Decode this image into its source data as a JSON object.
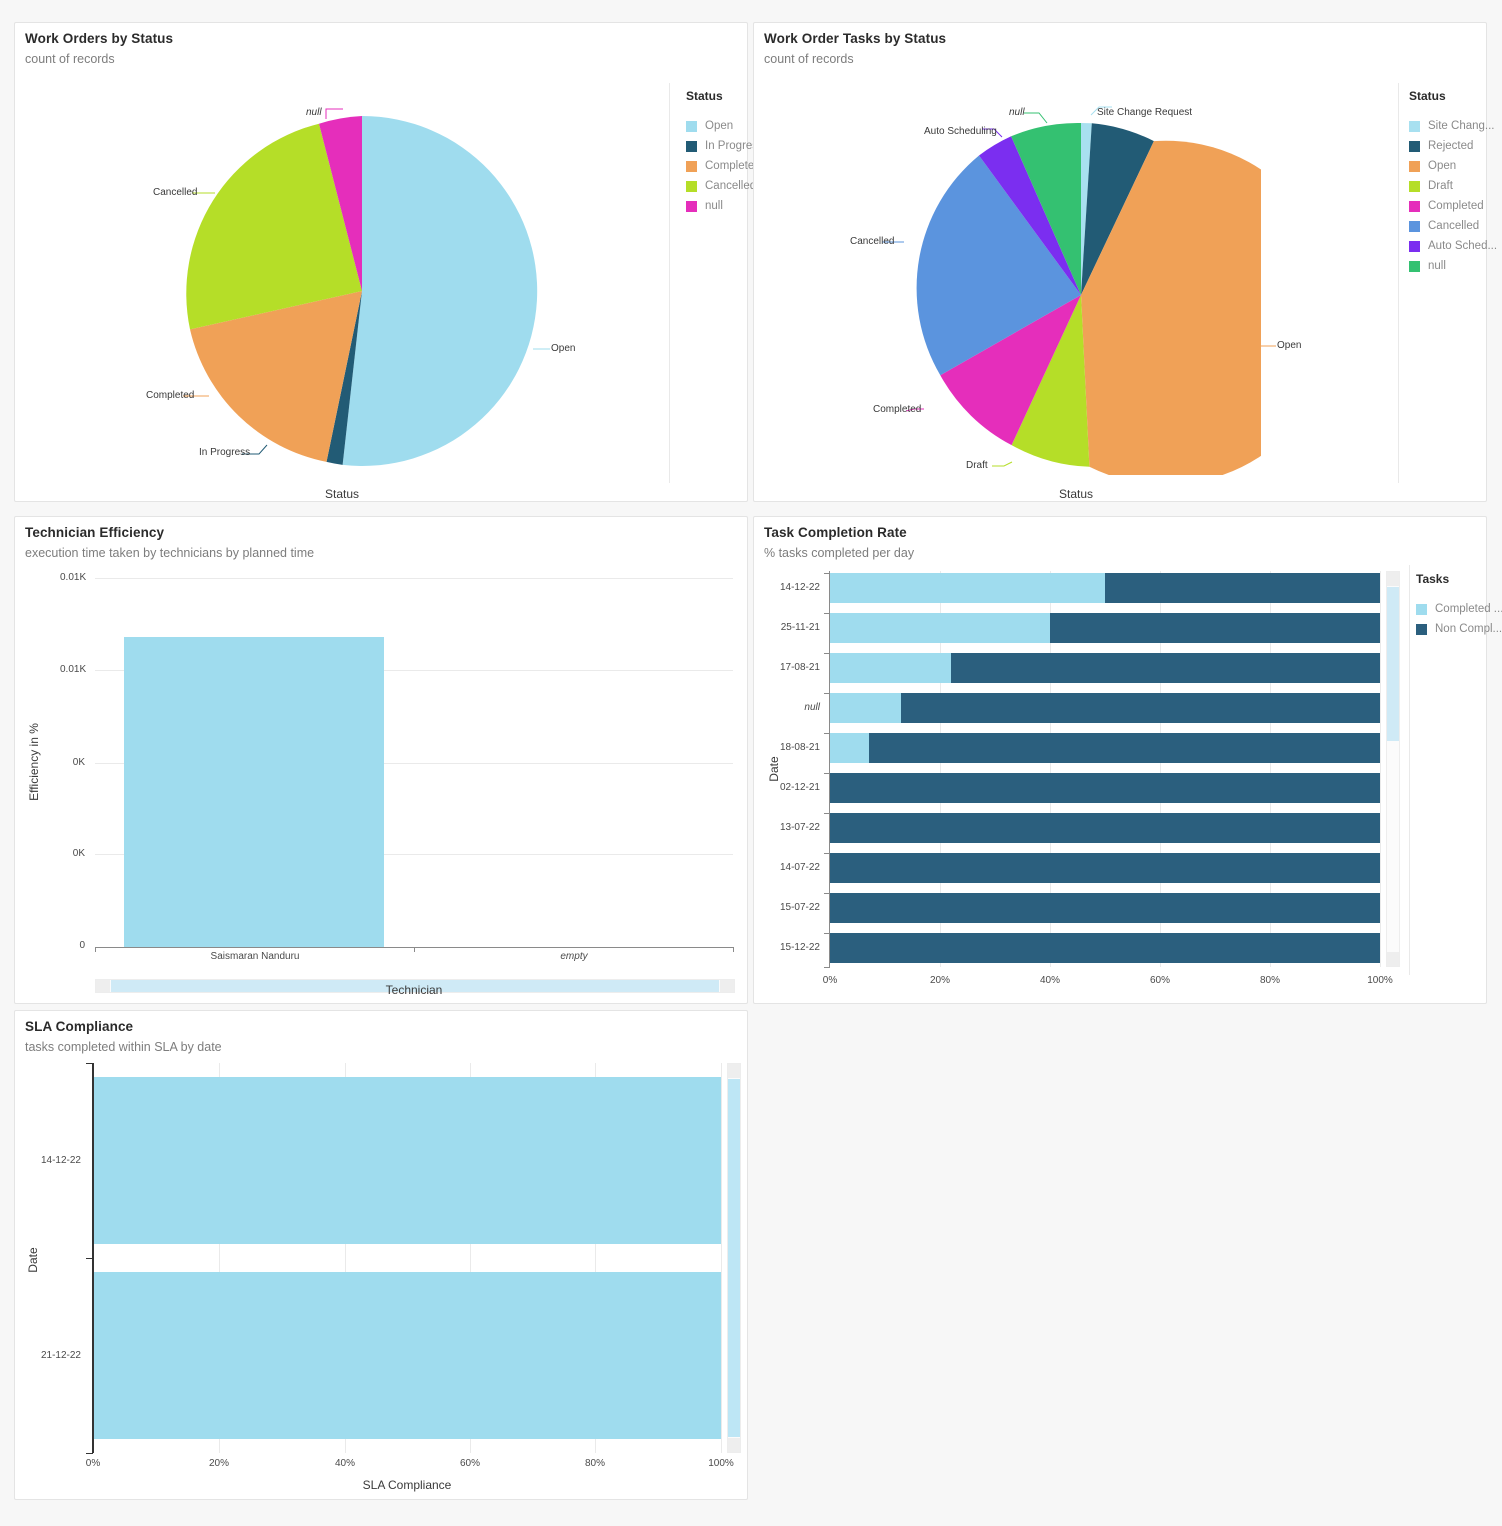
{
  "theme": {
    "page_bg": "#f7f7f7",
    "panel_bg": "#ffffff",
    "panel_border": "#e4e4e4",
    "text_dark": "#2b2b2b",
    "text_muted": "#7d7d7d",
    "light_blue": "#9fdcee",
    "dark_blue": "#2b5f7e"
  },
  "panels": {
    "work_orders": {
      "title": "Work Orders by Status",
      "subtitle": "count of records",
      "axis_title": "Status",
      "legend_title": "Status"
    },
    "work_order_tasks": {
      "title": "Work Order Tasks by Status",
      "subtitle": "count of records",
      "axis_title": "Status",
      "legend_title": "Status"
    },
    "technician_efficiency": {
      "title": "Technician Efficiency",
      "subtitle": "execution time taken by technicians by planned time",
      "x_axis_title": "Technician",
      "y_axis_title": "Efficiency in %"
    },
    "task_completion": {
      "title": "Task Completion Rate",
      "subtitle": "% tasks completed per day",
      "y_axis_title": "Date",
      "legend_title": "Tasks"
    },
    "sla_compliance": {
      "title": "SLA Compliance",
      "subtitle": "tasks completed within SLA by date",
      "x_axis_title": "SLA Compliance",
      "y_axis_title": "Date"
    }
  },
  "chart_data": [
    {
      "id": "work_orders_by_status",
      "type": "pie",
      "title": "Work Orders by Status",
      "subtitle": "count of records",
      "xlabel": "Status",
      "legend_title": "Status",
      "legend_position": "right",
      "labels": [
        "Open",
        "In Progress",
        "Completed",
        "Cancelled",
        "null"
      ],
      "values": [
        56.5,
        1.5,
        11.5,
        26.5,
        4.0
      ],
      "unit": "percent",
      "colors": [
        "#9fdcee",
        "#225b75",
        "#f0a157",
        "#b5de28",
        "#e52ebb"
      ],
      "slice_labels": [
        {
          "text": "Open",
          "italic": false
        },
        {
          "text": "In Progress",
          "italic": false
        },
        {
          "text": "Completed",
          "italic": false
        },
        {
          "text": "Cancelled",
          "italic": false
        },
        {
          "text": "null",
          "italic": true
        }
      ],
      "legend_entries": [
        "Open",
        "In Progress",
        "Completed",
        "Cancelled",
        "null"
      ]
    },
    {
      "id": "work_order_tasks_by_status",
      "type": "pie",
      "title": "Work Order Tasks by Status",
      "subtitle": "count of records",
      "xlabel": "Status",
      "legend_title": "Status",
      "legend_position": "right",
      "labels": [
        "Site Change Request",
        "Rejected",
        "Open",
        "Draft",
        "Completed",
        "Cancelled",
        "Auto Scheduling",
        "null"
      ],
      "values": [
        1.0,
        6.5,
        43.0,
        7.5,
        8.0,
        22.0,
        3.5,
        8.5
      ],
      "unit": "percent",
      "colors": [
        "#a8e0f0",
        "#225b75",
        "#f0a157",
        "#b5de28",
        "#e52ebb",
        "#5b94de",
        "#7b2ef0",
        "#34c171"
      ],
      "slice_labels": [
        {
          "text": "Site Change Request",
          "italic": false
        },
        {
          "text": "Open",
          "italic": false
        },
        {
          "text": "Draft",
          "italic": false
        },
        {
          "text": "Completed",
          "italic": false
        },
        {
          "text": "Cancelled",
          "italic": false
        },
        {
          "text": "Auto Scheduling",
          "italic": false
        },
        {
          "text": "null",
          "italic": true
        }
      ],
      "legend_entries": [
        "Site Chang...",
        "Rejected",
        "Open",
        "Draft",
        "Completed",
        "Cancelled",
        "Auto Sched...",
        "null"
      ]
    },
    {
      "id": "technician_efficiency",
      "type": "bar",
      "title": "Technician Efficiency",
      "subtitle": "execution time taken by technicians by planned time",
      "xlabel": "Technician",
      "ylabel": "Efficiency in %",
      "categories": [
        "Saismaran Nanduru",
        "empty"
      ],
      "category_italic": [
        false,
        true
      ],
      "values": [
        0.0082,
        0
      ],
      "ytick_labels": [
        "0.01K",
        "0.01K",
        "0K",
        "0K",
        "0"
      ],
      "ylim": [
        0,
        0.01
      ],
      "bar_color": "#9fdcee",
      "grid": true,
      "has_horizontal_scrollbar": true
    },
    {
      "id": "task_completion_rate",
      "type": "bar",
      "orientation": "horizontal",
      "stacked": true,
      "stack_mode": "percent",
      "title": "Task Completion Rate",
      "subtitle": "% tasks completed per day",
      "ylabel": "Date",
      "legend_title": "Tasks",
      "legend_position": "right",
      "categories": [
        "14-12-22",
        "25-11-21",
        "17-08-21",
        "null",
        "18-08-21",
        "02-12-21",
        "13-07-22",
        "14-07-22",
        "15-07-22",
        "15-12-22"
      ],
      "category_italic": [
        false,
        false,
        false,
        true,
        false,
        false,
        false,
        false,
        false,
        false
      ],
      "series": [
        {
          "name": "Completed ...",
          "color": "#9fdcee",
          "values": [
            50,
            40,
            22,
            13,
            7,
            0,
            0,
            0,
            0,
            0
          ]
        },
        {
          "name": "Non Compl...",
          "color": "#2b5f7e",
          "values": [
            50,
            60,
            78,
            87,
            93,
            100,
            100,
            100,
            100,
            100
          ]
        }
      ],
      "xtick_labels": [
        "0%",
        "20%",
        "40%",
        "60%",
        "80%",
        "100%"
      ],
      "xlim": [
        0,
        100
      ],
      "legend_entries": [
        "Completed ...",
        "Non Compl..."
      ],
      "has_vertical_scrollbar": true
    },
    {
      "id": "sla_compliance",
      "type": "bar",
      "orientation": "horizontal",
      "title": "SLA Compliance",
      "subtitle": "tasks completed within SLA by date",
      "xlabel": "SLA Compliance",
      "ylabel": "Date",
      "categories": [
        "14-12-22",
        "21-12-22"
      ],
      "values": [
        100,
        100
      ],
      "xtick_labels": [
        "0%",
        "20%",
        "40%",
        "60%",
        "80%",
        "100%"
      ],
      "xlim": [
        0,
        100
      ],
      "bar_color": "#9fdcee",
      "has_vertical_scrollbar": true
    }
  ]
}
